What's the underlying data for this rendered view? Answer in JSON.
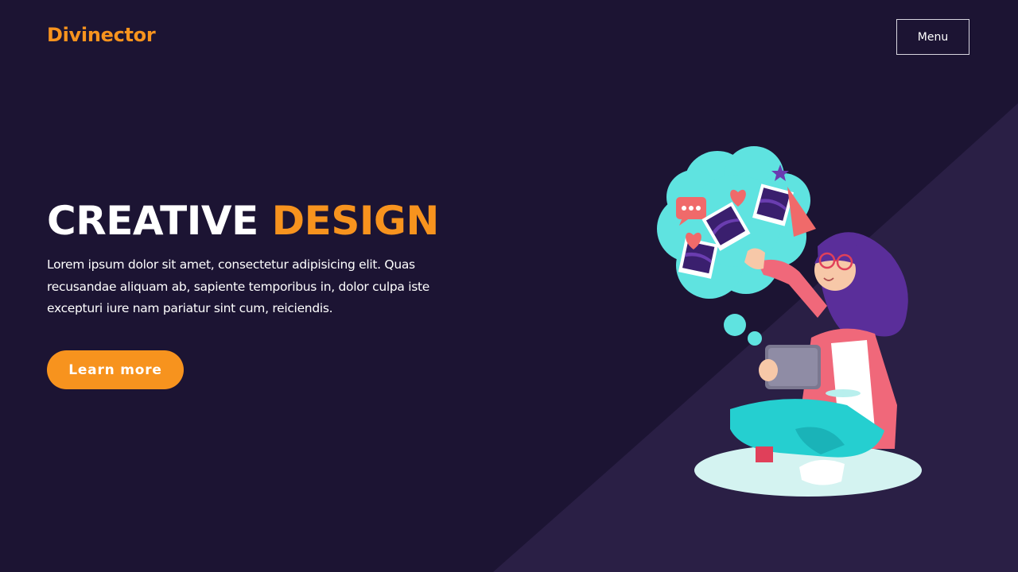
{
  "header": {
    "logo": "Divinector",
    "menu_label": "Menu"
  },
  "hero": {
    "title_main": "CREATIVE",
    "title_accent": "DESIGN",
    "text": "Lorem ipsum dolor sit amet, consectetur adipisicing elit. Quas recusandae aliquam ab, sapiente temporibus in, dolor culpa iste excepturi iure nam pariatur sint cum, reiciendis.",
    "cta_label": "Learn more"
  },
  "illustration": {
    "icon": "woman-with-tablet-illustration"
  },
  "colors": {
    "background": "#1c1433",
    "curve": "#2a1f45",
    "accent": "#f7931e",
    "text": "#ffffff",
    "cloud": "#5fe3e0"
  }
}
